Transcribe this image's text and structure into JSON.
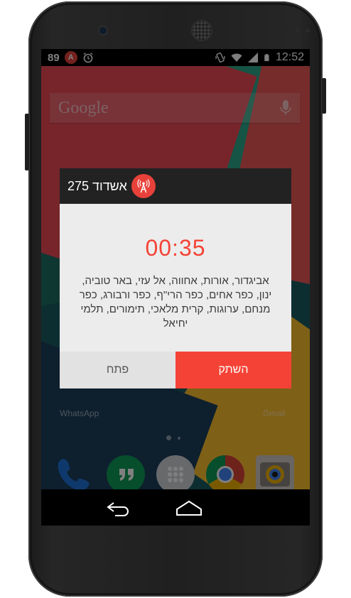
{
  "status_bar": {
    "notification_count": "89",
    "app_badge_letter": "A",
    "time": "12:52",
    "icons": [
      "app-badge-icon",
      "alarm-icon",
      "vibrate-icon",
      "wifi-icon",
      "signal-icon",
      "battery-icon"
    ]
  },
  "search": {
    "placeholder": "Google",
    "icon": "mic-icon"
  },
  "home": {
    "app_labels": {
      "whatsapp": "WhatsApp",
      "gmail": "Gmail"
    },
    "dock_icons": [
      "phone-icon",
      "hangouts-icon",
      "apps-drawer-icon",
      "chrome-icon",
      "camera-icon"
    ]
  },
  "alert": {
    "title": "אשדוד 275",
    "icon": "antenna-icon",
    "countdown": "00:35",
    "cities": "אביגדור, אורות, אחווה, אל עזי, באר טוביה, ינון, כפר אחים, כפר הרי\"ף, כפר ורבורג, כפר מנחם, ערוגות, קרית מלאכי, תימורים, תלמי יחיאל",
    "buttons": {
      "open": "פתח",
      "mute": "השתק"
    }
  },
  "colors": {
    "accent": "#f44336",
    "header": "#222222",
    "dialog_bg": "#ececec"
  },
  "nav": {
    "icons": [
      "back-icon",
      "home-icon"
    ]
  }
}
